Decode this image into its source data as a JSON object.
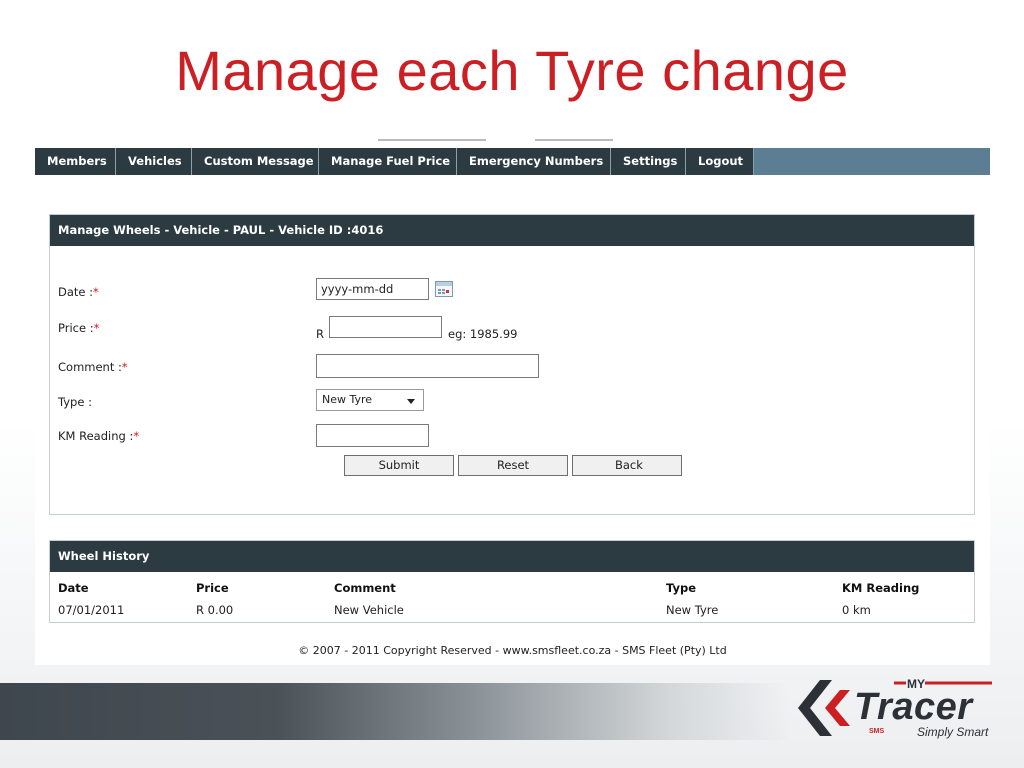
{
  "slide": {
    "title": "Manage each Tyre change"
  },
  "nav": {
    "items": [
      "Members",
      "Vehicles",
      "Custom Message",
      "Manage Fuel Price",
      "Emergency Numbers",
      "Settings",
      "Logout"
    ]
  },
  "form": {
    "header": "Manage Wheels - Vehicle - PAUL - Vehicle ID :4016",
    "date_label": "Date :",
    "date_value": "yyyy-mm-dd",
    "price_label": "Price :",
    "price_currency": "R",
    "price_value": "",
    "price_example": "eg: 1985.99",
    "comment_label": "Comment :",
    "comment_value": "",
    "type_label": "Type :",
    "type_selected": "New Tyre",
    "km_label": "KM Reading :",
    "km_value": "",
    "required_mark": "*",
    "submit_label": "Submit",
    "reset_label": "Reset",
    "back_label": "Back"
  },
  "history": {
    "header": "Wheel History",
    "columns": [
      "Date",
      "Price",
      "Comment",
      "Type",
      "KM Reading"
    ],
    "rows": [
      [
        "07/01/2011",
        "R 0.00",
        "New Vehicle",
        "New Tyre",
        "0 km"
      ]
    ]
  },
  "footer": {
    "copyright": "© 2007 - 2011 Copyright Reserved - www.smsfleet.co.za - SMS Fleet (Pty) Ltd"
  },
  "brand": {
    "my": "MY",
    "name": "Tracer",
    "sms": "SMS",
    "tagline": "Simply Smart",
    "accent": "#cc1f24",
    "dark": "#2c3a42"
  }
}
